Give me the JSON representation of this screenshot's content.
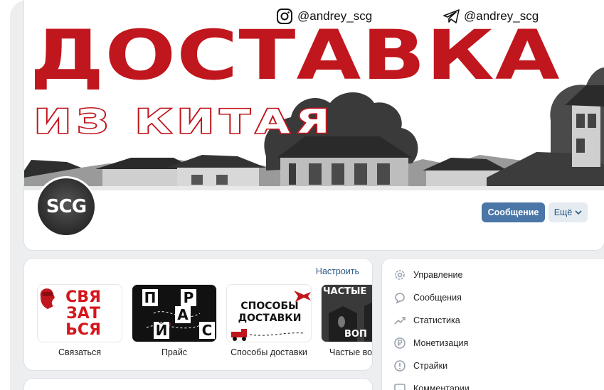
{
  "cover": {
    "title_line1": "ДОСТАВКА",
    "title_line2": "ИЗ КИТАЯ",
    "instagram": "@andrey_scg",
    "telegram": "@andrey_scg",
    "accent_color": "#c0161d"
  },
  "profile": {
    "avatar_text": "SCG",
    "message_button": "Сообщение",
    "more_button": "Ещё"
  },
  "widgets": {
    "configure": "Настроить",
    "tiles": [
      {
        "label": "Связаться",
        "art": [
          "СВЯ",
          "ЗАТ",
          "ЬСЯ"
        ]
      },
      {
        "label": "Прайс",
        "art": [
          "П",
          "Р",
          "Й",
          "А",
          "С"
        ]
      },
      {
        "label": "Способы доставки",
        "art": [
          "СПОСОБЫ",
          "ДОСТАВКИ"
        ]
      },
      {
        "label": "Частые вопросы",
        "art": [
          "ЧАСТЫЕ",
          "ВОП"
        ]
      }
    ]
  },
  "menu": {
    "items": [
      {
        "label": "Управление",
        "icon": "gear-icon"
      },
      {
        "label": "Сообщения",
        "icon": "message-icon"
      },
      {
        "label": "Статистика",
        "icon": "chart-icon"
      },
      {
        "label": "Монетизация",
        "icon": "ruble-icon"
      },
      {
        "label": "Страйки",
        "icon": "warning-icon"
      },
      {
        "label": "Комментарии",
        "icon": "comment-icon"
      }
    ]
  }
}
